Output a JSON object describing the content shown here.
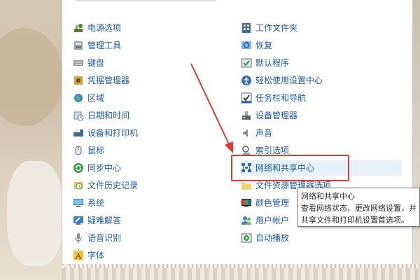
{
  "window": {
    "title_partial": ""
  },
  "left_column": [
    {
      "label": "电源选项",
      "icon": "power-options-icon"
    },
    {
      "label": "管理工具",
      "icon": "admin-tools-icon"
    },
    {
      "label": "键盘",
      "icon": "keyboard-icon"
    },
    {
      "label": "凭据管理器",
      "icon": "credential-manager-icon"
    },
    {
      "label": "区域",
      "icon": "region-icon"
    },
    {
      "label": "日期和时间",
      "icon": "date-time-icon"
    },
    {
      "label": "设备和打印机",
      "icon": "devices-printers-icon"
    },
    {
      "label": "鼠标",
      "icon": "mouse-icon"
    },
    {
      "label": "同步中心",
      "icon": "sync-center-icon"
    },
    {
      "label": "文件历史记录",
      "icon": "file-history-icon"
    },
    {
      "label": "系统",
      "icon": "system-icon"
    },
    {
      "label": "疑难解答",
      "icon": "troubleshooting-icon"
    },
    {
      "label": "语音识别",
      "icon": "speech-recognition-icon"
    },
    {
      "label": "字体",
      "icon": "fonts-icon"
    }
  ],
  "right_column": [
    {
      "label": "工作文件夹",
      "icon": "work-folders-icon"
    },
    {
      "label": "恢复",
      "icon": "recovery-icon"
    },
    {
      "label": "默认程序",
      "icon": "default-programs-icon"
    },
    {
      "label": "轻松使用设置中心",
      "icon": "ease-of-access-icon"
    },
    {
      "label": "任务栏和导航",
      "icon": "taskbar-navigation-icon"
    },
    {
      "label": "设备管理器",
      "icon": "device-manager-icon"
    },
    {
      "label": "声音",
      "icon": "sound-icon"
    },
    {
      "label": "索引选项",
      "icon": "indexing-options-icon"
    },
    {
      "label": "网络和共享中心",
      "icon": "network-sharing-icon"
    },
    {
      "label": "文件资源管理器选项",
      "icon": "file-explorer-options-icon"
    },
    {
      "label": "颜色管理",
      "icon": "color-management-icon"
    },
    {
      "label": "用户帐户",
      "icon": "user-accounts-icon"
    },
    {
      "label": "自动播放",
      "icon": "autoplay-icon"
    }
  ],
  "tooltip": {
    "title": "网络和共享中心",
    "line1": "查看网络状态、更改网络设置，并",
    "line2": "共享文件和打印机设置首选项。"
  },
  "colors": {
    "link": "#1e5aa8",
    "hover_bg": "#e5f1fb",
    "annotation_red": "#e53935"
  }
}
